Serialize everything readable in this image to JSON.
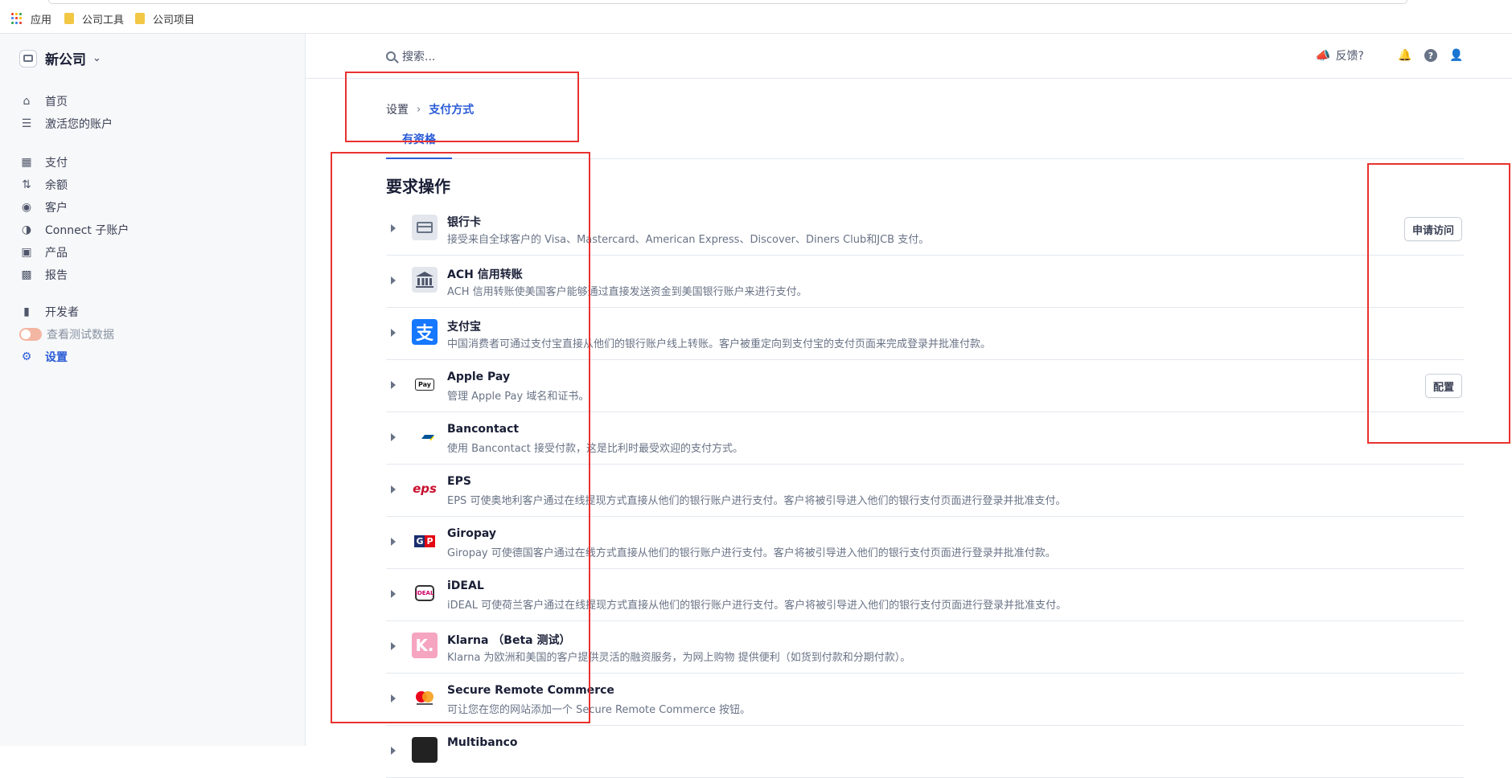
{
  "bookmarks": {
    "apps_label": "应用",
    "items": [
      {
        "label": "公司工具"
      },
      {
        "label": "公司项目"
      }
    ],
    "apps_grid_colors": [
      "#ea4335",
      "#fbbc05",
      "#34a853",
      "#4285f4",
      "#ea4335",
      "#fbbc05",
      "#34a853",
      "#4285f4",
      "#ea4335"
    ]
  },
  "sidebar": {
    "company_name": "新公司",
    "items": [
      {
        "label": "首页",
        "icon": "home-icon"
      },
      {
        "label": "激活您的账户",
        "icon": "edit-list-icon"
      },
      {
        "label": "支付",
        "icon": "payments-icon"
      },
      {
        "label": "余额",
        "icon": "balance-arrows-icon"
      },
      {
        "label": "客户",
        "icon": "customer-icon"
      },
      {
        "label": "Connect 子账户",
        "icon": "connect-icon"
      },
      {
        "label": "产品",
        "icon": "product-box-icon"
      },
      {
        "label": "报告",
        "icon": "report-icon"
      },
      {
        "label": "开发者",
        "icon": "terminal-icon"
      },
      {
        "label": "查看测试数据",
        "icon": "toggle-icon"
      },
      {
        "label": "设置",
        "icon": "gear-icon"
      }
    ]
  },
  "topbar": {
    "search_placeholder": "搜索...",
    "feedback_label": "反馈?"
  },
  "breadcrumb": {
    "root": "设置",
    "current": "支付方式"
  },
  "tabs": [
    {
      "label": "有资格"
    }
  ],
  "section_title": "要求操作",
  "payment_methods": [
    {
      "name": "银行卡",
      "desc": "接受来自全球客户的 Visa、Mastercard、American Express、Discover、Diners Club和JCB 支付。",
      "button": "申请访问"
    },
    {
      "name": "ACH 信用转账",
      "desc": "ACH 信用转账使美国客户能够通过直接发送资金到美国银行账户来进行支付。"
    },
    {
      "name": "支付宝",
      "desc": "中国消费者可通过支付宝直接从他们的银行账户线上转账。客户被重定向到支付宝的支付页面来完成登录并批准付款。"
    },
    {
      "name": "Apple Pay",
      "desc": "管理 Apple Pay 域名和证书。",
      "button": "配置"
    },
    {
      "name": "Bancontact",
      "desc": "使用 Bancontact 接受付款，这是比利时最受欢迎的支付方式。"
    },
    {
      "name": "EPS",
      "desc": "EPS 可使奥地利客户通过在线提现方式直接从他们的银行账户进行支付。客户将被引导进入他们的银行支付页面进行登录并批准支付。"
    },
    {
      "name": "Giropay",
      "desc": "Giropay 可使德国客户通过在线方式直接从他们的银行账户进行支付。客户将被引导进入他们的银行支付页面进行登录并批准付款。"
    },
    {
      "name": "iDEAL",
      "desc": "iDEAL 可使荷兰客户通过在线提现方式直接从他们的银行账户进行支付。客户将被引导进入他们的银行支付页面进行登录并批准支付。"
    },
    {
      "name": "Klarna （Beta 测试）",
      "desc": "Klarna 为欧洲和美国的客户提供灵活的融资服务，为网上购物 提供便利（如货到付款和分期付款）。"
    },
    {
      "name": "Secure Remote Commerce",
      "desc": "可让您在您的网站添加一个 Secure Remote Commerce 按钮。"
    },
    {
      "name": "Multibanco",
      "desc": ""
    }
  ],
  "logo_text": {
    "alipay": "支",
    "apple_pay": "Pay",
    "eps": "eps",
    "giropay_g": "G",
    "giropay_p": "P",
    "ideal": "iDEAL",
    "klarna": "K."
  },
  "colors": {
    "accent": "#2a5bd7",
    "annotation": "#e8322f",
    "alipay": "#1677ff",
    "klarna": "#f5a5c0"
  }
}
